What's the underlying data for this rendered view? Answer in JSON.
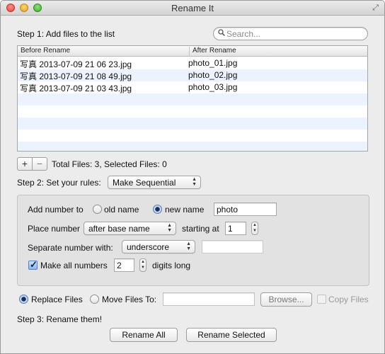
{
  "window": {
    "title": "Rename It"
  },
  "step1": {
    "label": "Step 1: Add files to the list",
    "search": {
      "placeholder": "Search...",
      "value": ""
    },
    "table": {
      "columns": [
        "Before Rename",
        "After Rename"
      ],
      "rows": [
        {
          "before": "写真 2013-07-09 21 06 23.jpg",
          "after": "photo_01.jpg"
        },
        {
          "before": "写真 2013-07-09 21 08 49.jpg",
          "after": "photo_02.jpg"
        },
        {
          "before": "写真 2013-07-09 21 03 43.jpg",
          "after": "photo_03.jpg"
        }
      ]
    },
    "add_label": "+",
    "remove_label": "−",
    "status": "Total Files: 3,  Selected Files: 0"
  },
  "step2": {
    "label": "Step 2: Set your rules:",
    "rule_select": "Make Sequential",
    "add_number_to": "Add number to",
    "old_name": "old name",
    "new_name": "new name",
    "new_name_selected": true,
    "name_value": "photo",
    "place_number": "Place number",
    "place_select": "after base name",
    "starting_at": "starting at",
    "start_value": "1",
    "separate_label": "Separate number with:",
    "separator_select": "underscore",
    "separator_custom": "",
    "make_all": "Make all numbers",
    "make_all_checked": true,
    "digits_value": "2",
    "digits_long": "digits long"
  },
  "options": {
    "replace_files": "Replace Files",
    "replace_selected": true,
    "move_files_to": "Move Files To:",
    "move_path": "",
    "browse": "Browse...",
    "copy_files": "Copy Files"
  },
  "step3": {
    "label": "Step 3: Rename them!",
    "rename_all": "Rename All",
    "rename_selected": "Rename Selected"
  },
  "icons": {
    "search": "magnifier-icon",
    "resize": "fullscreen-arrows-icon"
  }
}
